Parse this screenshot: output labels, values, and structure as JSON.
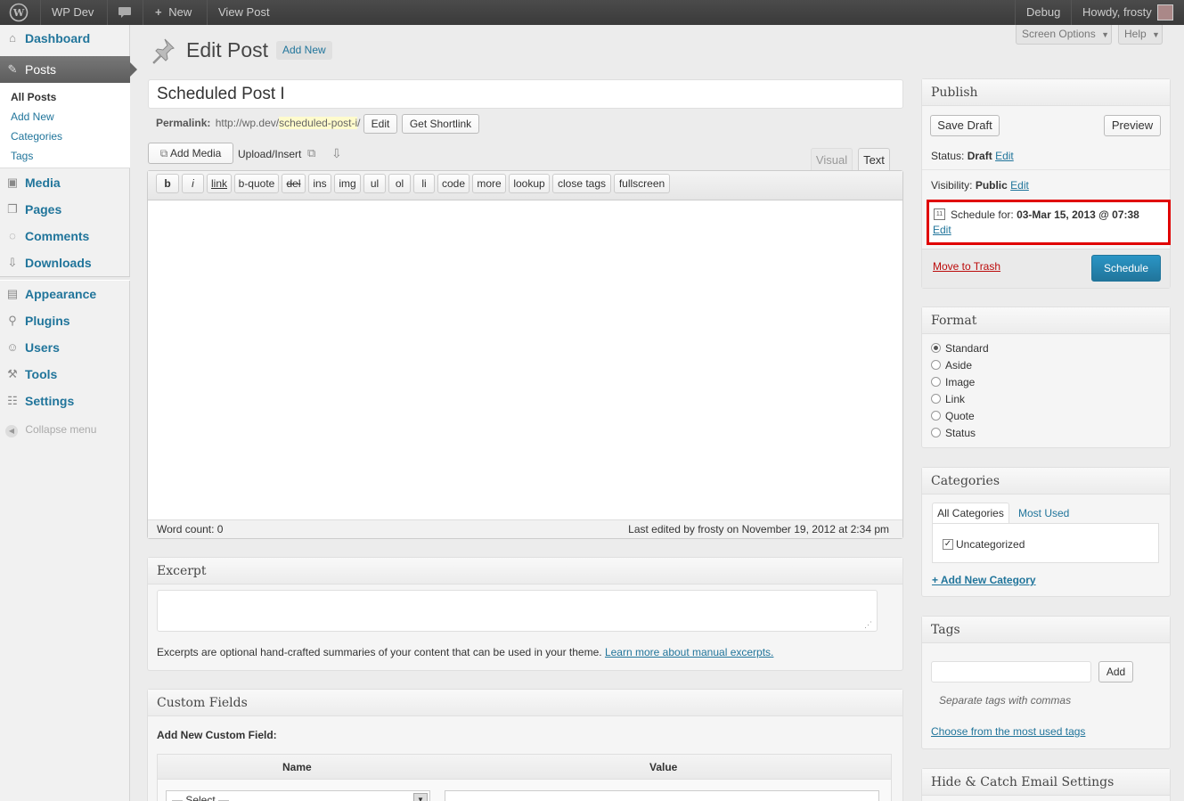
{
  "adminbar": {
    "site_name": "WP Dev",
    "new_label": "New",
    "view_post": "View Post",
    "debug": "Debug",
    "howdy": "Howdy, frosty"
  },
  "sidebar": {
    "dashboard": "Dashboard",
    "posts": "Posts",
    "submenu": [
      "All Posts",
      "Add New",
      "Categories",
      "Tags"
    ],
    "media": "Media",
    "pages": "Pages",
    "comments": "Comments",
    "downloads": "Downloads",
    "appearance": "Appearance",
    "plugins": "Plugins",
    "users": "Users",
    "tools": "Tools",
    "settings": "Settings",
    "collapse": "Collapse menu"
  },
  "header": {
    "title": "Edit Post",
    "add_new": "Add New",
    "screen_options": "Screen Options",
    "help": "Help"
  },
  "post": {
    "title": "Scheduled Post I",
    "permalink_label": "Permalink:",
    "permalink_base": "http://wp.dev/",
    "permalink_slug": "scheduled-post-i",
    "permalink_end": "/",
    "edit_btn": "Edit",
    "shortlink_btn": "Get Shortlink"
  },
  "editor": {
    "add_media": "Add Media",
    "upload_insert": "Upload/Insert",
    "tab_visual": "Visual",
    "tab_text": "Text",
    "quicktags": [
      "b",
      "i",
      "link",
      "b-quote",
      "del",
      "ins",
      "img",
      "ul",
      "ol",
      "li",
      "code",
      "more",
      "lookup",
      "close tags",
      "fullscreen"
    ],
    "word_count": "Word count: 0",
    "last_edited": "Last edited by frosty on November 19, 2012 at 2:34 pm"
  },
  "excerpt": {
    "title": "Excerpt",
    "help": "Excerpts are optional hand-crafted summaries of your content that can be used in your theme.",
    "link": "Learn more about manual excerpts."
  },
  "custom_fields": {
    "title": "Custom Fields",
    "add_new": "Add New Custom Field:",
    "col_name": "Name",
    "col_value": "Value",
    "select": "— Select —"
  },
  "publish": {
    "title": "Publish",
    "save_draft": "Save Draft",
    "preview": "Preview",
    "status_label": "Status:",
    "status_value": "Draft",
    "visibility_label": "Visibility:",
    "visibility_value": "Public",
    "edit": "Edit",
    "schedule_label": "Schedule for:",
    "schedule_value": "03-Mar 15, 2013 @ 07:38",
    "trash": "Move to Trash",
    "schedule_btn": "Schedule",
    "highlight_color": "#e00000"
  },
  "format": {
    "title": "Format",
    "options": [
      "Standard",
      "Aside",
      "Image",
      "Link",
      "Quote",
      "Status"
    ],
    "selected": "Standard"
  },
  "categories": {
    "title": "Categories",
    "tab_all": "All Categories",
    "tab_used": "Most Used",
    "items": [
      "Uncategorized"
    ],
    "add_new": "+ Add New Category"
  },
  "tags": {
    "title": "Tags",
    "add_btn": "Add",
    "help": "Separate tags with commas",
    "choose": "Choose from the most used tags"
  },
  "email_box": {
    "title": "Hide & Catch Email Settings"
  }
}
